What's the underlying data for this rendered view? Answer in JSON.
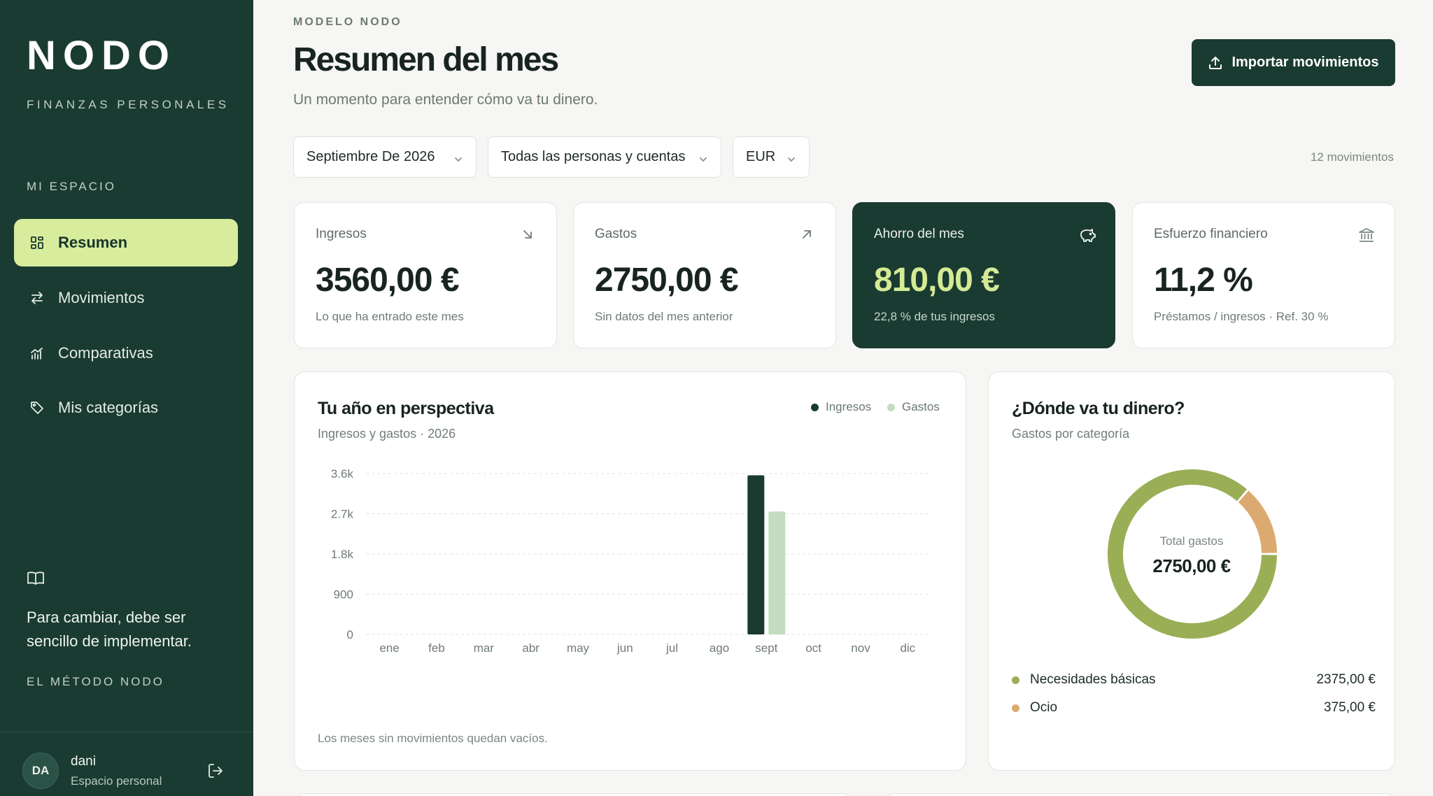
{
  "brand": {
    "logo": "NODO",
    "tagline": "FINANZAS PERSONALES"
  },
  "sidebar": {
    "section_label": "MI ESPACIO",
    "items": [
      {
        "label": "Resumen",
        "icon": "grid-icon",
        "active": true
      },
      {
        "label": "Movimientos",
        "icon": "swap-arrows-icon",
        "active": false
      },
      {
        "label": "Comparativas",
        "icon": "bar-trend-icon",
        "active": false
      },
      {
        "label": "Mis categorías",
        "icon": "tag-icon",
        "active": false
      }
    ],
    "quote": "Para cambiar, debe ser sencillo de implementar.",
    "method_link": "EL MÉTODO NODO",
    "user": {
      "initials": "DA",
      "name": "dani",
      "subtitle": "Espacio personal"
    }
  },
  "header": {
    "eyebrow": "MODELO NODO",
    "title": "Resumen del mes",
    "subtitle": "Un momento para entender cómo va tu dinero.",
    "import_button": "Importar movimientos"
  },
  "filters": {
    "period": "Septiembre De 2026",
    "scope": "Todas las personas y cuentas",
    "currency": "EUR",
    "movements_count": "12 movimientos"
  },
  "kpis": [
    {
      "label": "Ingresos",
      "value": "3560,00 €",
      "note": "Lo que ha entrado este mes",
      "icon": "arrow-down-right-icon"
    },
    {
      "label": "Gastos",
      "value": "2750,00 €",
      "note": "Sin datos del mes anterior",
      "icon": "arrow-up-right-icon"
    },
    {
      "label": "Ahorro del mes",
      "value": "810,00 €",
      "note": "22,8 % de tus ingresos",
      "icon": "piggy-bank-icon"
    },
    {
      "label": "Esfuerzo financiero",
      "value": "11,2 %",
      "note": "Préstamos / ingresos · Ref. 30 %",
      "icon": "bank-icon"
    }
  ],
  "year_card": {
    "title": "Tu año en perspectiva",
    "subtitle": "Ingresos y gastos · 2026",
    "footnote": "Los meses sin movimientos quedan vacíos."
  },
  "category_card": {
    "title": "¿Dónde va tu dinero?",
    "subtitle": "Gastos por categoría",
    "center_label": "Total gastos",
    "center_value": "2750,00 €",
    "categories": [
      {
        "name": "Necesidades básicas",
        "amount": "2375,00 €",
        "value": 2375,
        "color": "#9aae55"
      },
      {
        "name": "Ocio",
        "amount": "375,00 €",
        "value": 375,
        "color": "#dcaa70"
      }
    ]
  },
  "colors": {
    "accent": "#1a3b31",
    "highlight": "#d8ec9e",
    "income": "#1a3b31",
    "expense": "#c4dcc0"
  },
  "chart_data": {
    "type": "bar",
    "categories": [
      "ene",
      "feb",
      "mar",
      "abr",
      "may",
      "jun",
      "jul",
      "ago",
      "sept",
      "oct",
      "nov",
      "dic"
    ],
    "series": [
      {
        "name": "Ingresos",
        "color": "#1a3b31",
        "values": [
          0,
          0,
          0,
          0,
          0,
          0,
          0,
          0,
          3560,
          0,
          0,
          0
        ]
      },
      {
        "name": "Gastos",
        "color": "#c4dcc0",
        "values": [
          0,
          0,
          0,
          0,
          0,
          0,
          0,
          0,
          2750,
          0,
          0,
          0
        ]
      }
    ],
    "yticks": [
      0,
      900,
      1800,
      2700,
      3600
    ],
    "ytick_labels": [
      "0",
      "900",
      "1.8k",
      "2.7k",
      "3.6k"
    ],
    "ylim": [
      0,
      3600
    ],
    "grid": true,
    "legend": "top-right"
  }
}
